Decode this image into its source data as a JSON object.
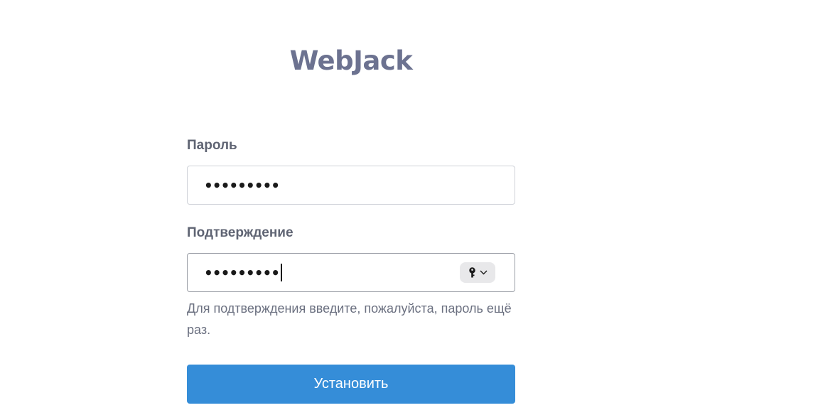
{
  "logo": {
    "text": "WebJack"
  },
  "form": {
    "password": {
      "label": "Пароль",
      "value_masked": "•••••••••"
    },
    "confirm": {
      "label": "Подтверждение",
      "value_masked": "•••••••••",
      "hint": "Для подтверждения введите, пожалуйста, пароль ещё раз.",
      "password_manager_icon": "key-icon"
    },
    "submit_label": "Установить"
  },
  "colors": {
    "logo": "#6c7290",
    "label": "#5f6473",
    "hint": "#6b7080",
    "button": "#358dd8",
    "button_text": "#ffffff",
    "input_border": "#cfd2d8"
  }
}
